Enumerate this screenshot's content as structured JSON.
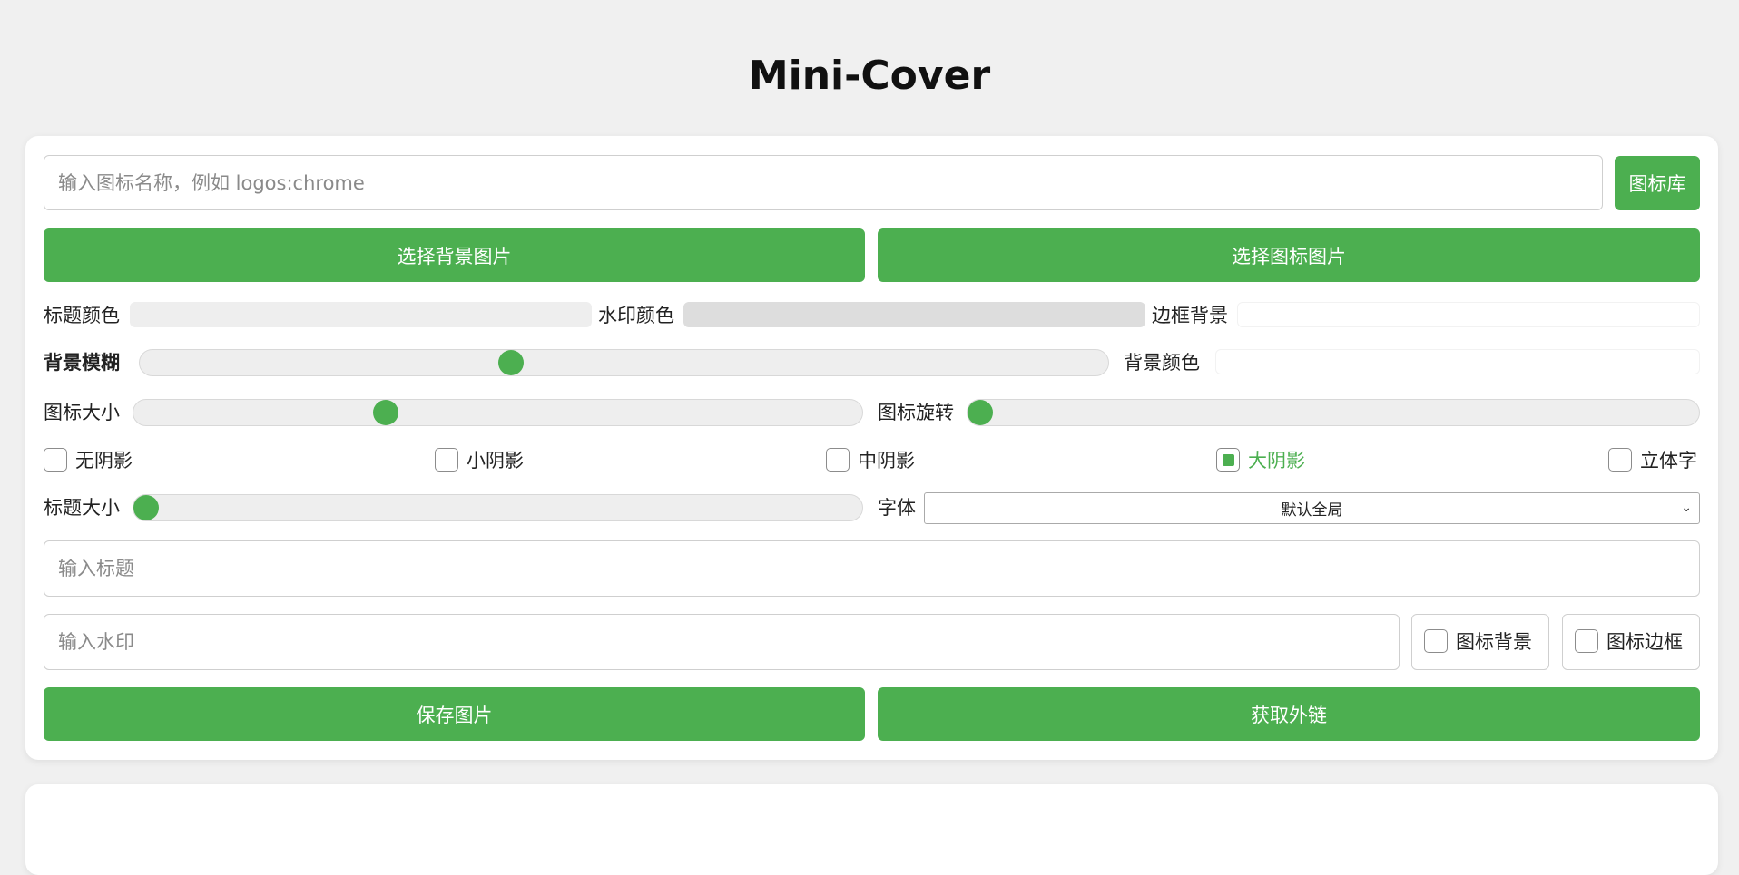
{
  "app": {
    "title": "Mini-Cover"
  },
  "icon_search": {
    "placeholder": "输入图标名称，例如 logos:chrome",
    "button": "图标库"
  },
  "image_buttons": {
    "background": "选择背景图片",
    "icon": "选择图标图片"
  },
  "colors_row": {
    "title_color_label": "标题颜色",
    "title_color": "#eeeeee",
    "watermark_color_label": "水印颜色",
    "watermark_color": "#dddddd",
    "border_bg_label": "边框背景",
    "border_bg": "#ffffff"
  },
  "blur_row": {
    "blur_label": "背景模糊",
    "blur_value_fraction": 0.38,
    "bg_color_label": "背景颜色",
    "bg_color": "#ffffff"
  },
  "icon_row": {
    "size_label": "图标大小",
    "size_value_fraction": 0.34,
    "rotate_label": "图标旋转",
    "rotate_value_fraction": 0.0
  },
  "shadow_options": [
    {
      "label": "无阴影",
      "checked": false
    },
    {
      "label": "小阴影",
      "checked": false
    },
    {
      "label": "中阴影",
      "checked": false
    },
    {
      "label": "大阴影",
      "checked": true
    },
    {
      "label": "立体字",
      "checked": false
    }
  ],
  "title_row": {
    "size_label": "标题大小",
    "size_value_fraction": 0.0,
    "font_label": "字体",
    "font_value": "默认全局"
  },
  "title_input": {
    "placeholder": "输入标题"
  },
  "watermark_input": {
    "placeholder": "输入水印"
  },
  "toggles": {
    "icon_bg": "图标背景",
    "icon_border": "图标边框"
  },
  "actions": {
    "save": "保存图片",
    "link": "获取外链"
  },
  "accent_color": "#4caf50"
}
